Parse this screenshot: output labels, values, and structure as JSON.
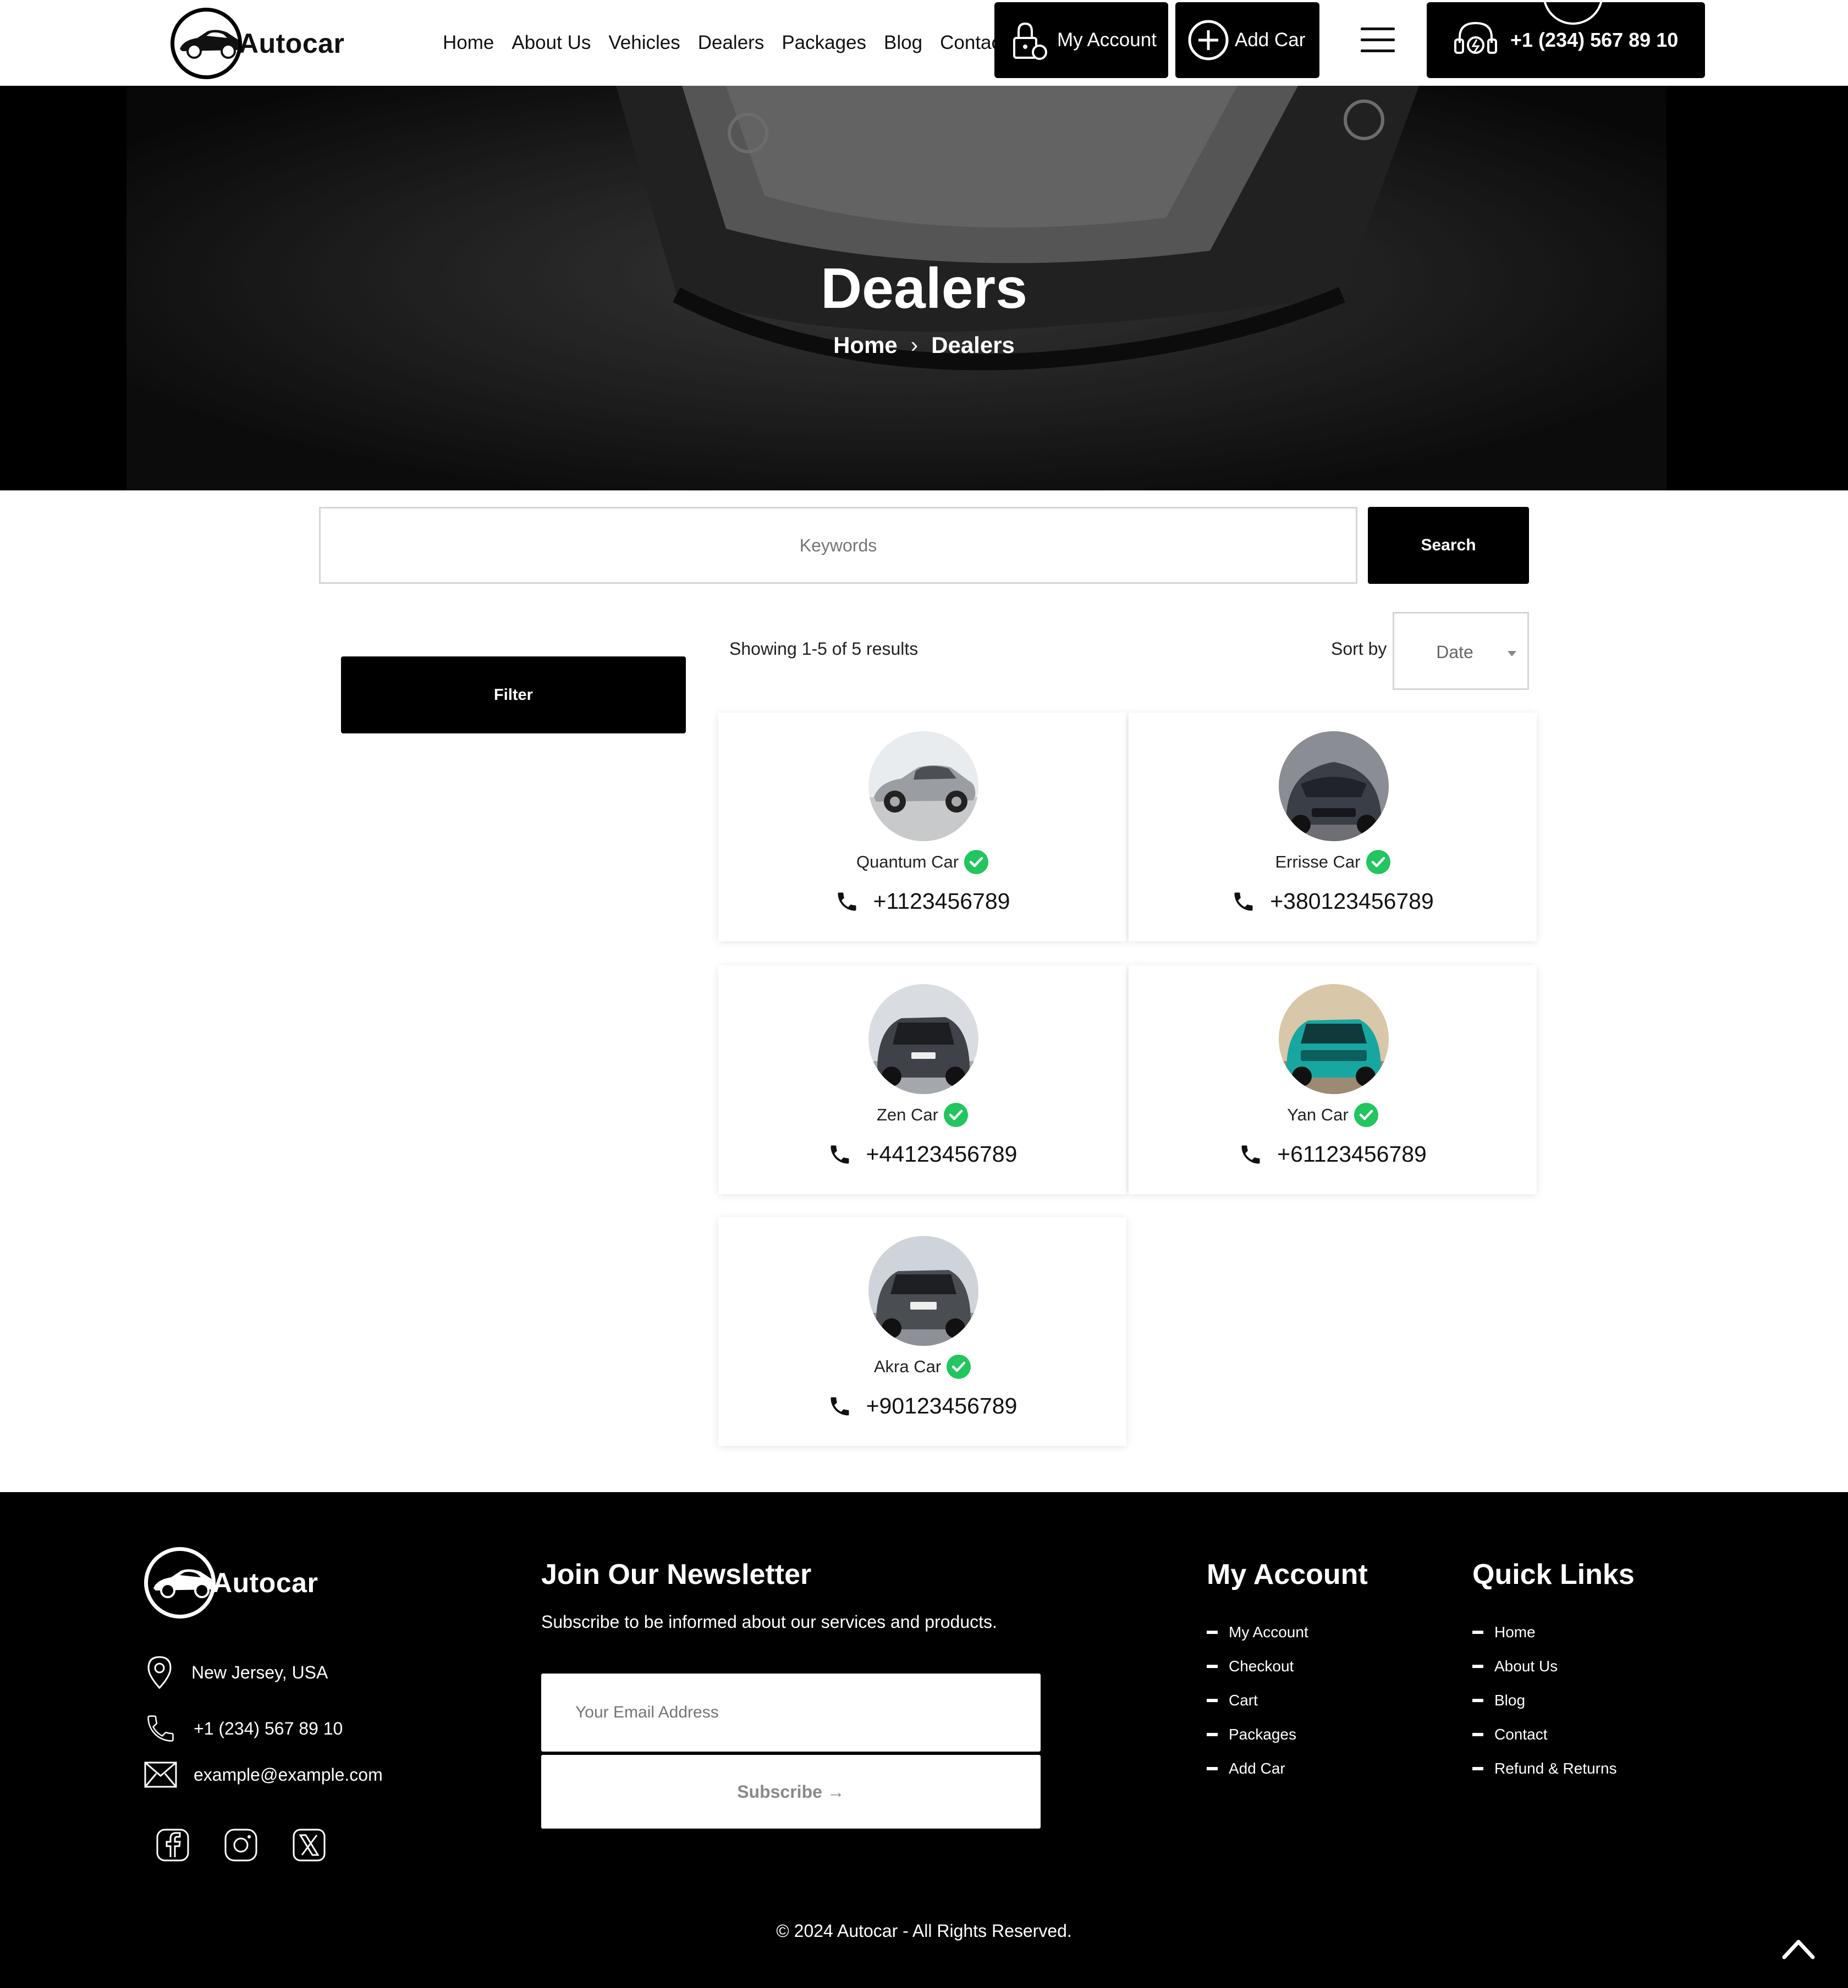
{
  "brand": {
    "name": "Autocar"
  },
  "nav": {
    "items": [
      "Home",
      "About Us",
      "Vehicles",
      "Dealers",
      "Packages",
      "Blog",
      "Contact"
    ],
    "my_account_label": "My Account",
    "add_car_label": "Add Car",
    "phone_label": "+1 (234) 567 89 10"
  },
  "hero": {
    "title": "Dealers",
    "breadcrumb": {
      "home": "Home",
      "current": "Dealers"
    }
  },
  "search": {
    "placeholder": "Keywords",
    "button_label": "Search"
  },
  "filter": {
    "button_label": "Filter"
  },
  "results": {
    "summary": "Showing 1-5 of 5 results",
    "sort_label": "Sort by",
    "sort_value": "Date"
  },
  "dealers": [
    {
      "name": "Quantum Car",
      "phone": "+1123456789",
      "verified": true,
      "car_color": "#9a9ea3"
    },
    {
      "name": "Errisse Car",
      "phone": "+380123456789",
      "verified": true,
      "car_color": "#3a3e47"
    },
    {
      "name": "Zen Car",
      "phone": "+44123456789",
      "verified": true,
      "car_color": "#3f4248"
    },
    {
      "name": "Yan Car",
      "phone": "+61123456789",
      "verified": true,
      "car_color": "#17a7a0"
    },
    {
      "name": "Akra Car",
      "phone": "+90123456789",
      "verified": true,
      "car_color": "#4a4d52"
    }
  ],
  "footer": {
    "contact": {
      "address": "New Jersey, USA",
      "phone": "+1 (234) 567 89 10",
      "email": "example@example.com"
    },
    "socials": [
      "facebook-icon",
      "instagram-icon",
      "x-icon"
    ],
    "newsletter": {
      "title": "Join Our Newsletter",
      "subtitle": "Subscribe to be informed about our services and products.",
      "placeholder": "Your Email Address",
      "button_label": "Subscribe →"
    },
    "my_account": {
      "title": "My Account",
      "links": [
        "My Account",
        "Checkout",
        "Cart",
        "Packages",
        "Add Car"
      ]
    },
    "quick_links": {
      "title": "Quick Links",
      "links": [
        "Home",
        "About Us",
        "Blog",
        "Contact",
        "Refund & Returns"
      ]
    },
    "copyright": "© 2024 Autocar - All Rights Reserved."
  },
  "colors": {
    "primary": "#000000",
    "verified": "#22c55e",
    "background": "#ffffff"
  }
}
